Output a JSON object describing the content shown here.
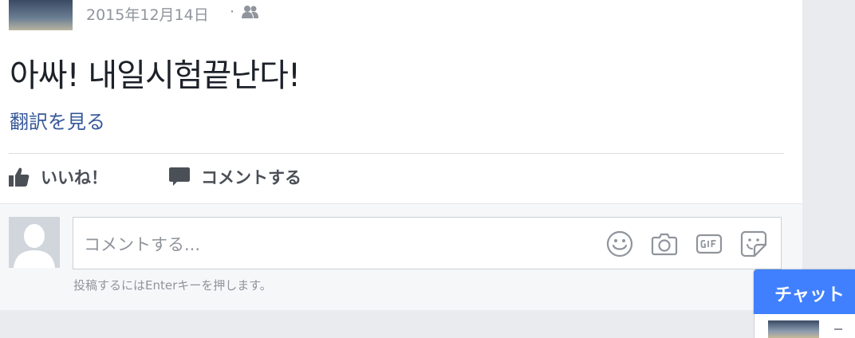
{
  "post": {
    "date": "2015年12月14日",
    "separator": "·",
    "text": "아싸! 내일시험끝난다!",
    "translate_link": "翻訳を見る"
  },
  "actions": {
    "like_label": "いいね！",
    "comment_label": "コメントする"
  },
  "comment_input": {
    "placeholder": "コメントする...",
    "hint": "投稿するにはEnterキーを押します。",
    "icons": [
      "smiley-icon",
      "camera-icon",
      "gif-icon",
      "sticker-icon"
    ]
  },
  "chat": {
    "label": "チャット"
  },
  "colors": {
    "link": "#365899",
    "chat_accent": "#4080ff",
    "muted": "#90949c",
    "action_text": "#4b4f56"
  }
}
